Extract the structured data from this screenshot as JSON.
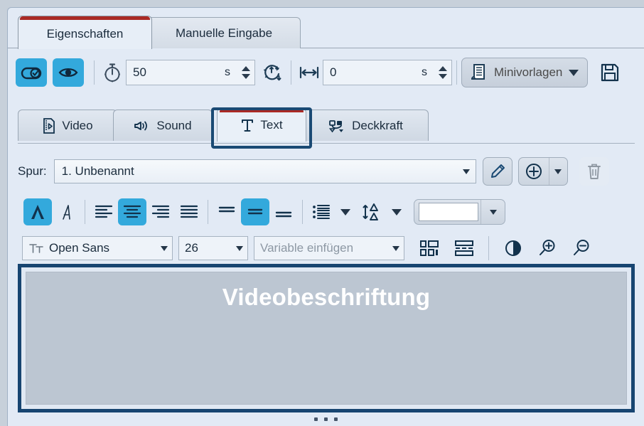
{
  "window": {
    "tabs": [
      {
        "id": "eigenschaften",
        "label": "Eigenschaften",
        "active": true
      },
      {
        "id": "manuelle",
        "label": "Manuelle Eingabe",
        "active": false
      }
    ]
  },
  "toolbar": {
    "toggle_enabled_icon": "toggle-switch-check-icon",
    "toggle_visible_icon": "eye-icon",
    "duration_icon": "stopwatch-icon",
    "duration_value": "50",
    "duration_unit": "s",
    "animation_icon": "clock-animation-icon",
    "delay_icon": "horizontal-arrows-icon",
    "delay_value": "0",
    "delay_unit": "s",
    "minivorlagen_label": "Minivorlagen",
    "minivorlagen_icon": "document-list-icon",
    "save_icon": "floppy-save-icon"
  },
  "subtabs": [
    {
      "id": "video",
      "label": "Video",
      "icon": "video-file-icon",
      "selected": false
    },
    {
      "id": "sound",
      "label": "Sound",
      "icon": "speaker-icon",
      "selected": false
    },
    {
      "id": "text",
      "label": "Text",
      "icon": "text-T-icon",
      "selected": true
    },
    {
      "id": "deckkraft",
      "label": "Deckkraft",
      "icon": "opacity-icon",
      "selected": false
    }
  ],
  "track": {
    "label": "Spur:",
    "value": "1. Unbenannt",
    "edit_icon": "pencil-icon",
    "add_icon": "plus-circle-icon",
    "delete_icon": "trash-icon"
  },
  "format": {
    "style_solid_icon": "bold-A-icon",
    "style_italic_icon": "italic-A-icon",
    "align_left_icon": "align-left-icon",
    "align_center_icon": "align-center-icon",
    "align_right_icon": "align-right-icon",
    "align_justify_icon": "align-justify-icon",
    "valign_top_icon": "vertical-align-top-icon",
    "valign_middle_icon": "vertical-align-middle-icon",
    "valign_bottom_icon": "vertical-align-bottom-icon",
    "bullets_icon": "bullet-list-icon",
    "linespacing_icon": "line-spacing-icon",
    "color_swatch": "#ffffff",
    "active": [
      "style_solid",
      "align_center",
      "valign_middle"
    ]
  },
  "font": {
    "family_icon": "font-TT-icon",
    "family": "Open Sans",
    "size": "26",
    "variable_placeholder": "Variable einfügen",
    "layout_left_icon": "layout-columns-icon",
    "layout_stack_icon": "layout-rows-icon",
    "contrast_icon": "contrast-icon",
    "zoom_in_icon": "zoom-in-icon",
    "zoom_out_icon": "zoom-out-icon"
  },
  "canvas": {
    "text": "Videobeschriftung",
    "background_color": "#bcc6d2",
    "border_color": "#174571",
    "text_color": "#ffffff"
  },
  "footer": {
    "drag_handle_icon": "three-dots-handle-icon"
  }
}
